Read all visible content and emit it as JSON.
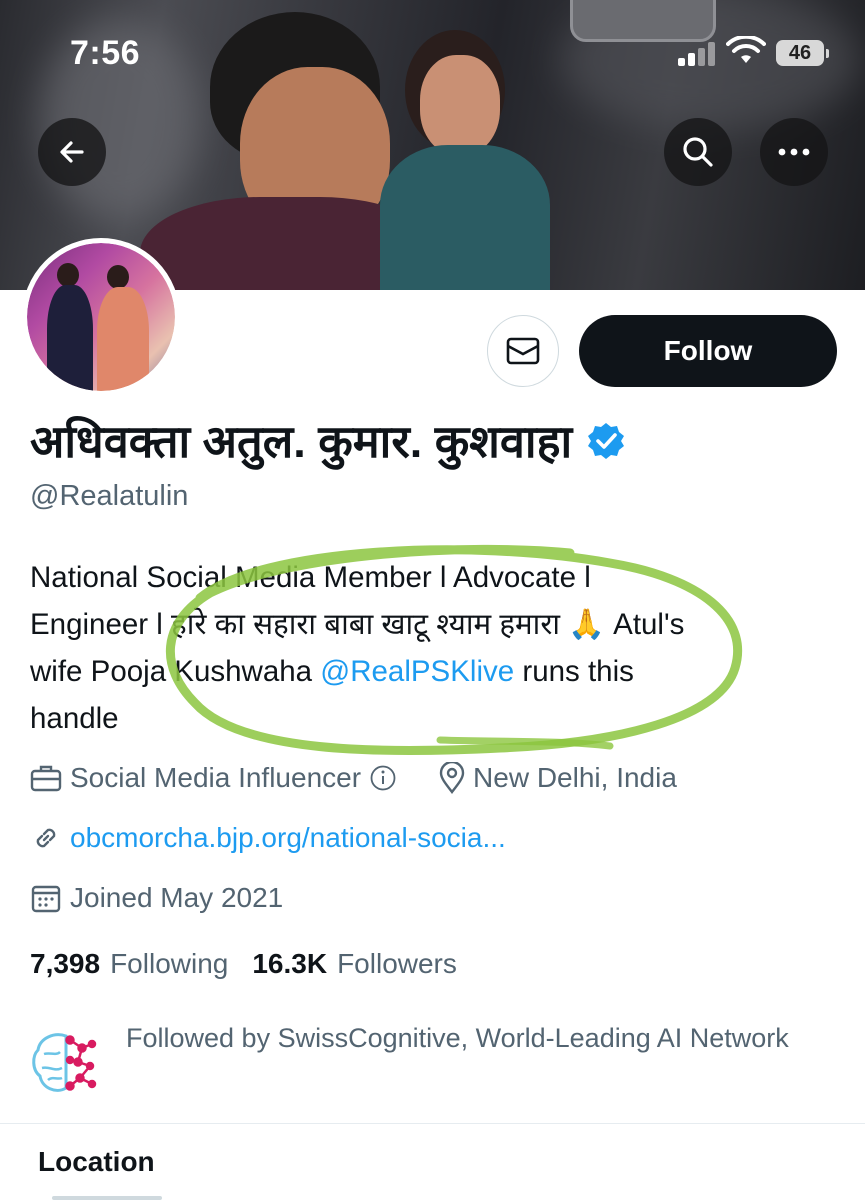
{
  "status_bar": {
    "time": "7:56",
    "battery": "46"
  },
  "header": {
    "back_icon": "arrow-left-icon",
    "search_icon": "search-icon",
    "more_icon": "more-horizontal-icon"
  },
  "profile": {
    "display_name": "अधिवक्ता अतुल. कुमार. कुशवाहा",
    "handle": "@Realatulin",
    "verified": true,
    "follow_label": "Follow",
    "bio": {
      "line1": "National Social Media Member l Advocate l",
      "line2_a": "Engineer l हारे का सहारा बाबा खाटू श्याम हमारा 🙏 Atul's",
      "line3_a": "wife Pooja Kushwaha ",
      "mention": "@RealPSKlive",
      "line3_b": " runs this",
      "line4": "handle"
    },
    "category": "Social Media Influencer",
    "location": "New Delhi, India",
    "website": "obcmorcha.bjp.org/national-socia...",
    "joined": "Joined May 2021",
    "following_count": "7,398",
    "following_label": "Following",
    "followers_count": "16.3K",
    "followers_label": "Followers",
    "followed_by": "Followed by SwissCognitive, World-Leading AI Network"
  },
  "tabs": {
    "location": "Location"
  },
  "colors": {
    "accent": "#1d9bf0",
    "text_primary": "#0f1419",
    "text_secondary": "#536471",
    "annotation_green": "#8cc63f"
  }
}
